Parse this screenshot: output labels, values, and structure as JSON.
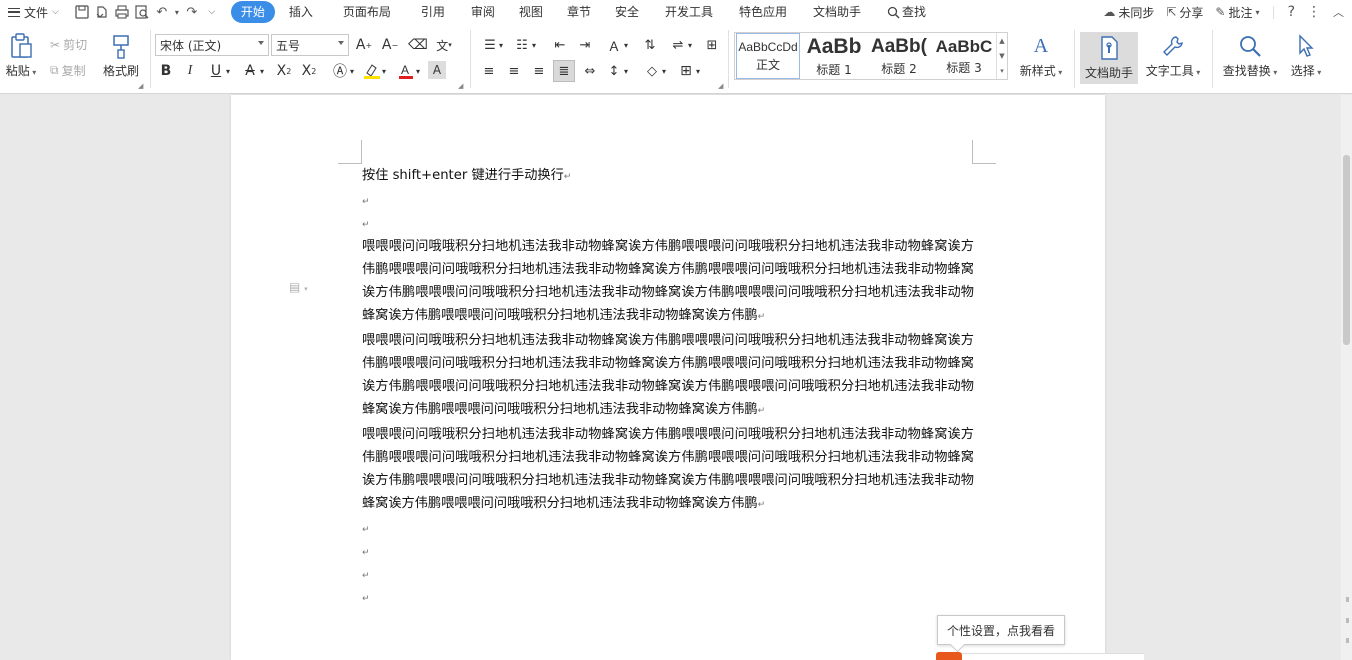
{
  "tabbar": {
    "file_menu": "文件",
    "tabs": [
      "开始",
      "插入",
      "页面布局",
      "引用",
      "审阅",
      "视图",
      "章节",
      "安全",
      "开发工具",
      "特色应用",
      "文档助手"
    ],
    "search": "查找",
    "sync": "未同步",
    "share": "分享",
    "annotate": "批注",
    "help": "?"
  },
  "ribbon": {
    "paste": "粘贴",
    "cut": "剪切",
    "copy": "复制",
    "format_painter": "格式刷",
    "font_name": "宋体 (正文)",
    "font_size": "五号",
    "bold": "B",
    "italic": "I",
    "underline": "U",
    "styles": [
      {
        "preview": "AaBbCcDd",
        "label": "正文"
      },
      {
        "preview": "AaBb",
        "label": "标题 1"
      },
      {
        "preview": "AaBb(",
        "label": "标题 2"
      },
      {
        "preview": "AaBbC",
        "label": "标题 3"
      }
    ],
    "new_style": "新样式",
    "doc_helper": "文档助手",
    "text_tools": "文字工具",
    "find_replace": "查找替换",
    "select": "选择"
  },
  "document": {
    "line1": "按住 shift+enter 键进行手动换行",
    "para1": "喂喂喂问问哦哦积分扫地机违法我非动物蜂窝诶方伟鹏喂喂喂问问哦哦积分扫地机违法我非动物蜂窝诶方伟鹏喂喂喂问问哦哦积分扫地机违法我非动物蜂窝诶方伟鹏喂喂喂问问哦哦积分扫地机违法我非动物蜂窝诶方伟鹏喂喂喂问问哦哦积分扫地机违法我非动物蜂窝诶方伟鹏喂喂喂问问哦哦积分扫地机违法我非动物蜂窝诶方伟鹏喂喂喂问问哦哦积分扫地机违法我非动物蜂窝诶方伟鹏",
    "para2": "喂喂喂问问哦哦积分扫地机违法我非动物蜂窝诶方伟鹏喂喂喂问问哦哦积分扫地机违法我非动物蜂窝诶方伟鹏喂喂喂问问哦哦积分扫地机违法我非动物蜂窝诶方伟鹏喂喂喂问问哦哦积分扫地机违法我非动物蜂窝诶方伟鹏喂喂喂问问哦哦积分扫地机违法我非动物蜂窝诶方伟鹏喂喂喂问问哦哦积分扫地机违法我非动物蜂窝诶方伟鹏喂喂喂问问哦哦积分扫地机违法我非动物蜂窝诶方伟鹏",
    "para3": "喂喂喂问问哦哦积分扫地机违法我非动物蜂窝诶方伟鹏喂喂喂问问哦哦积分扫地机违法我非动物蜂窝诶方伟鹏喂喂喂问问哦哦积分扫地机违法我非动物蜂窝诶方伟鹏喂喂喂问问哦哦积分扫地机违法我非动物蜂窝诶方伟鹏喂喂喂问问哦哦积分扫地机违法我非动物蜂窝诶方伟鹏喂喂喂问问哦哦积分扫地机违法我非动物蜂窝诶方伟鹏喂喂喂问问哦哦积分扫地机违法我非动物蜂窝诶方伟鹏",
    "para_mark": "↵"
  },
  "tooltip": "个性设置，点我看看",
  "colors": {
    "accent": "#3b8ee8",
    "highlight_yellow": "#ffe100",
    "font_red": "#e02020",
    "logo_orange": "#e8581c"
  }
}
